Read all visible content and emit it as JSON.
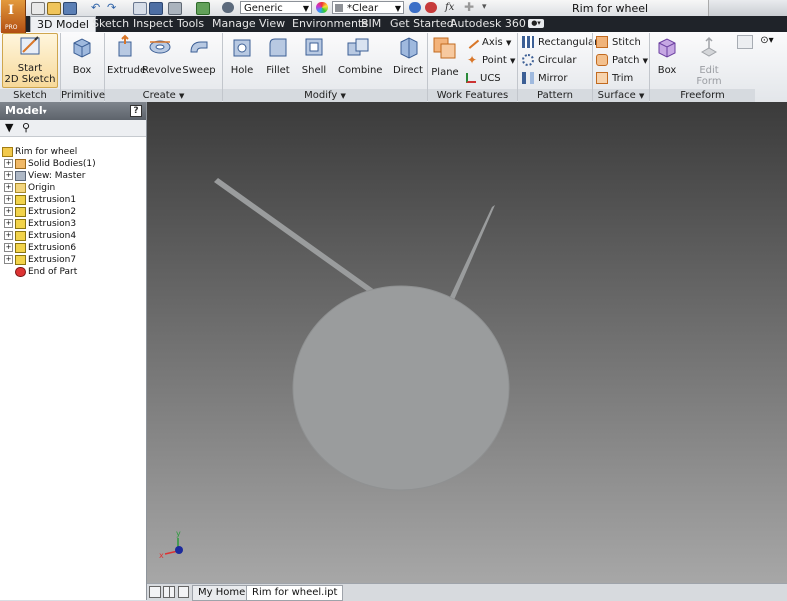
{
  "window": {
    "title": "Rim for wheel"
  },
  "app_button": {
    "letter": "I",
    "edition": "PRO"
  },
  "quick_access": {
    "material": "Generic",
    "appearance": "*Clear"
  },
  "tabs": [
    "3D Model",
    "Sketch",
    "Inspect",
    "Tools",
    "Manage",
    "View",
    "Environments",
    "BIM",
    "Get Started",
    "Autodesk 360"
  ],
  "ribbon": {
    "sketch": {
      "start_line1": "Start",
      "start_line2": "2D Sketch",
      "panel": "Sketch"
    },
    "primitives": {
      "box": "Box",
      "panel": "Primitives"
    },
    "create": {
      "extrude": "Extrude",
      "revolve": "Revolve",
      "sweep": "Sweep",
      "panel": "Create"
    },
    "modify": {
      "hole": "Hole",
      "fillet": "Fillet",
      "shell": "Shell",
      "combine": "Combine",
      "direct": "Direct",
      "panel": "Modify"
    },
    "work_features": {
      "plane": "Plane",
      "axis": "Axis",
      "point": "Point",
      "ucs": "UCS",
      "panel": "Work Features"
    },
    "pattern": {
      "rectangular": "Rectangular",
      "circular": "Circular",
      "mirror": "Mirror",
      "panel": "Pattern"
    },
    "surface": {
      "stitch": "Stitch",
      "patch": "Patch",
      "trim": "Trim",
      "panel": "Surface"
    },
    "freeform": {
      "box": "Box",
      "edit_form_line1": "Edit",
      "edit_form_line2": "Form",
      "panel": "Freeform"
    }
  },
  "browser": {
    "title": "Model",
    "tree": [
      {
        "label": "Rim for wheel",
        "icon": "part-icon",
        "expander": false
      },
      {
        "label": "Solid Bodies(1)",
        "icon": "solid-bodies-icon",
        "expander": true
      },
      {
        "label": "View: Master",
        "icon": "view-icon",
        "expander": true
      },
      {
        "label": "Origin",
        "icon": "folder-icon",
        "expander": true
      },
      {
        "label": "Extrusion1",
        "icon": "extrusion-icon",
        "expander": true
      },
      {
        "label": "Extrusion2",
        "icon": "extrusion-icon",
        "expander": true
      },
      {
        "label": "Extrusion3",
        "icon": "extrusion-icon",
        "expander": true
      },
      {
        "label": "Extrusion4",
        "icon": "extrusion-icon",
        "expander": true
      },
      {
        "label": "Extrusion6",
        "icon": "extrusion-icon",
        "expander": true
      },
      {
        "label": "Extrusion7",
        "icon": "extrusion-icon",
        "expander": true
      },
      {
        "label": "End of Part",
        "icon": "end-of-part-icon",
        "expander": false
      }
    ]
  },
  "viewcube_axes": {
    "x": "x",
    "y": "y"
  },
  "doc_tabs": [
    "My Home",
    "Rim for wheel.ipt"
  ],
  "colors": {
    "accent_orange": "#d9772a",
    "viewport_top": "#3b3b3b",
    "viewport_bottom": "#a7a7a7",
    "model_gray": "#9a9c9d"
  }
}
